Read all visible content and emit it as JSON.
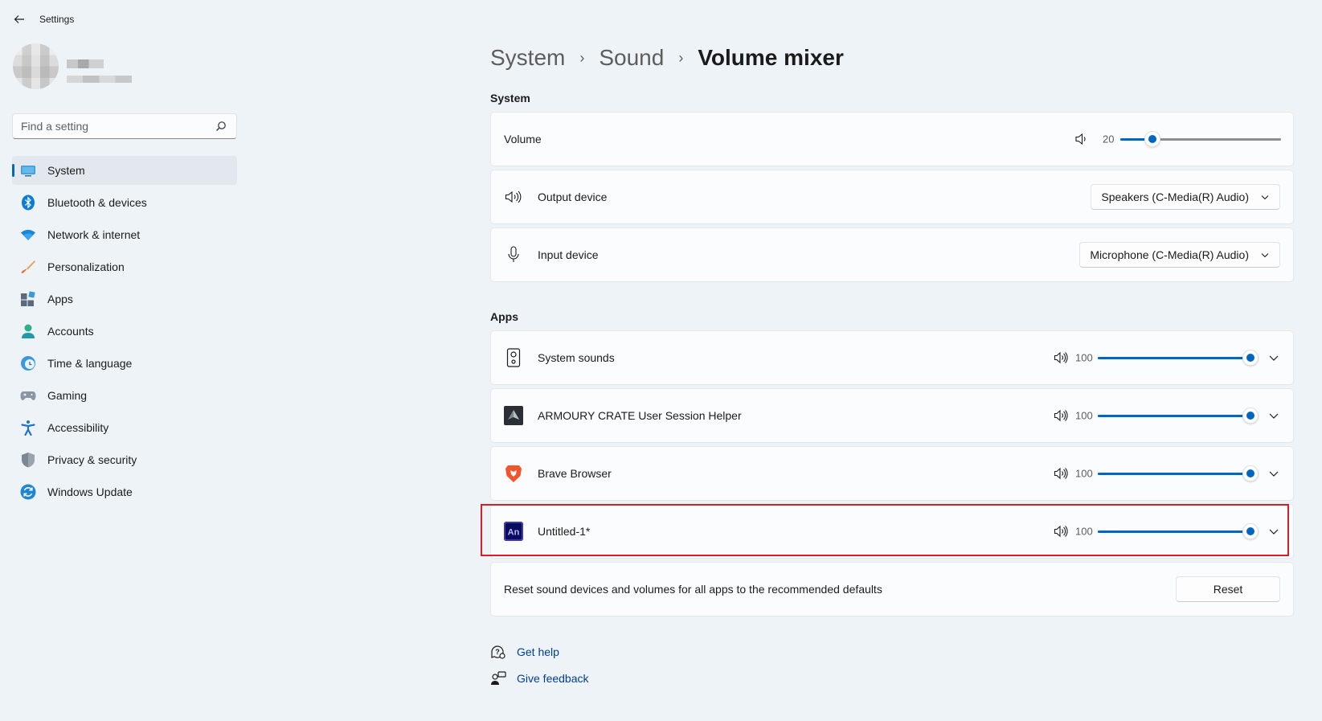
{
  "window": {
    "title": "Settings"
  },
  "search": {
    "placeholder": "Find a setting"
  },
  "sidebar": {
    "items": [
      {
        "label": "System",
        "icon": "system-icon",
        "active": true
      },
      {
        "label": "Bluetooth & devices",
        "icon": "bluetooth-icon"
      },
      {
        "label": "Network & internet",
        "icon": "wifi-icon"
      },
      {
        "label": "Personalization",
        "icon": "brush-icon"
      },
      {
        "label": "Apps",
        "icon": "apps-icon"
      },
      {
        "label": "Accounts",
        "icon": "account-icon"
      },
      {
        "label": "Time & language",
        "icon": "time-language-icon"
      },
      {
        "label": "Gaming",
        "icon": "gamepad-icon"
      },
      {
        "label": "Accessibility",
        "icon": "accessibility-icon"
      },
      {
        "label": "Privacy & security",
        "icon": "shield-icon"
      },
      {
        "label": "Windows Update",
        "icon": "update-icon"
      }
    ]
  },
  "breadcrumb": {
    "items": [
      "System",
      "Sound"
    ],
    "current": "Volume mixer"
  },
  "system_section": {
    "title": "System",
    "volume": {
      "label": "Volume",
      "value": "20",
      "level": 0.2
    },
    "output": {
      "label": "Output device",
      "selected": "Speakers (C-Media(R) Audio)"
    },
    "input": {
      "label": "Input device",
      "selected": "Microphone (C-Media(R) Audio)"
    }
  },
  "apps_section": {
    "title": "Apps",
    "apps": [
      {
        "name": "System sounds",
        "volume": "100",
        "level": 1.0,
        "icon": "system-sounds-icon"
      },
      {
        "name": "ARMOURY CRATE User Session Helper",
        "volume": "100",
        "level": 1.0,
        "icon": "armoury-crate-icon"
      },
      {
        "name": "Brave Browser",
        "volume": "100",
        "level": 1.0,
        "icon": "brave-icon"
      },
      {
        "name": "Untitled-1*",
        "volume": "100",
        "level": 1.0,
        "icon": "animate-icon",
        "app_badge": "An"
      }
    ]
  },
  "reset": {
    "description": "Reset sound devices and volumes for all apps to the recommended defaults",
    "button_label": "Reset"
  },
  "footer": {
    "get_help": "Get help",
    "give_feedback": "Give feedback"
  },
  "colors": {
    "accent": "#0067c0",
    "highlight": "#d61f26",
    "background": "#eef3f8"
  }
}
